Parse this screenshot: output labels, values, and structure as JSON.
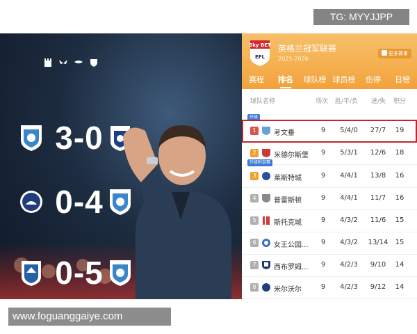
{
  "watermarks": {
    "tg": "TG: MYYJJPP",
    "url": "www.foguanggaiye.com"
  },
  "scores": [
    {
      "score": "3-0"
    },
    {
      "score": "0-4"
    },
    {
      "score": "0-5"
    }
  ],
  "league": {
    "logo_text": "Sky BET",
    "logo_sub": "EFL",
    "title": "英格兰冠军联赛",
    "season": "2025-2026",
    "more_label": "更多赛事"
  },
  "tabs": [
    "赛程",
    "排名",
    "球队榜",
    "球员榜",
    "伤停",
    "日榜"
  ],
  "columns": {
    "team": "球队名称",
    "played": "场次",
    "record": "胜/平/负",
    "goals": "进/失",
    "points": "积分"
  },
  "zones": {
    "promotion": "升级",
    "playoff": "升级附加赛"
  },
  "colors": {
    "accent_orange": "#f2a13b",
    "highlight_red": "#c0282d",
    "rank_red": "#d9534f",
    "rank_orange": "#f0a030",
    "rank_gray": "#b0b0b0"
  },
  "standings": [
    {
      "rank": "1",
      "team": "考文垂",
      "played": "9",
      "record": "5/4/0",
      "goals": "27/7",
      "points": "19"
    },
    {
      "rank": "2",
      "team": "米德尔斯堡",
      "played": "9",
      "record": "5/3/1",
      "goals": "12/6",
      "points": "18"
    },
    {
      "rank": "3",
      "team": "莱斯特城",
      "played": "9",
      "record": "4/4/1",
      "goals": "13/8",
      "points": "16"
    },
    {
      "rank": "4",
      "team": "普雷斯顿",
      "played": "9",
      "record": "4/4/1",
      "goals": "11/7",
      "points": "16"
    },
    {
      "rank": "5",
      "team": "斯托克城",
      "played": "9",
      "record": "4/3/2",
      "goals": "11/6",
      "points": "15"
    },
    {
      "rank": "6",
      "team": "女王公园...",
      "played": "9",
      "record": "4/3/2",
      "goals": "13/14",
      "points": "15"
    },
    {
      "rank": "7",
      "team": "西布罗姆...",
      "played": "9",
      "record": "4/2/3",
      "goals": "9/10",
      "points": "14"
    },
    {
      "rank": "8",
      "team": "米尔沃尔",
      "played": "9",
      "record": "4/2/3",
      "goals": "9/12",
      "points": "14"
    }
  ]
}
